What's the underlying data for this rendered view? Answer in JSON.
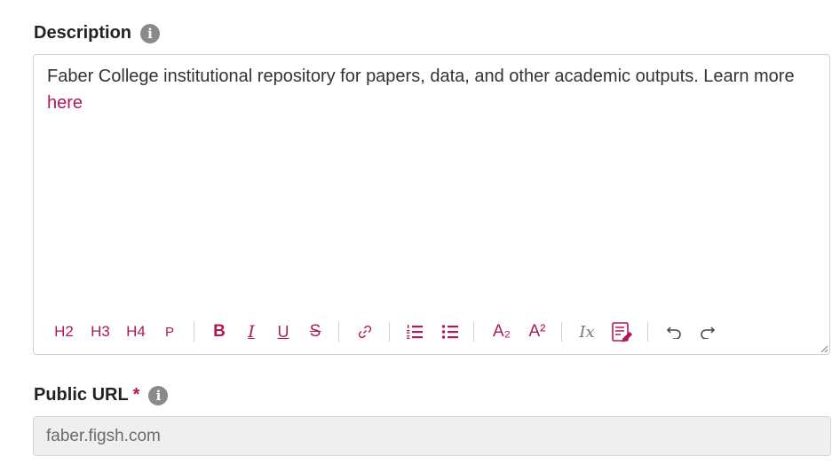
{
  "description": {
    "label": "Description",
    "info_icon": "info-icon",
    "content_text": "Faber College institutional repository for papers, data, and other academic outputs. Learn more",
    "content_link": "here"
  },
  "toolbar": {
    "h2": "H2",
    "h3": "H3",
    "h4": "H4",
    "p": "P",
    "bold": "B",
    "italic": "I",
    "underline": "U",
    "strike": "S",
    "subscript": "A₂",
    "superscript": "A²",
    "clear_format": "Ix",
    "icons": [
      "link-icon",
      "ordered-list-icon",
      "bullet-list-icon",
      "clear-format-icon",
      "source-edit-icon",
      "undo-icon",
      "redo-icon"
    ]
  },
  "public_url": {
    "label": "Public URL",
    "required_mark": "*",
    "value": "faber.figsh.com"
  },
  "colors": {
    "accent": "#b0185a",
    "info_icon": "#8a8a8a",
    "border": "#cfcfcf",
    "disabled_bg": "#efefef"
  }
}
